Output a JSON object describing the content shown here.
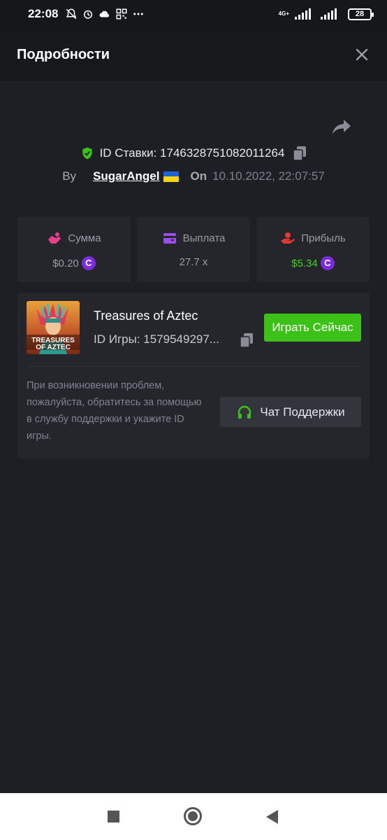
{
  "status_bar": {
    "time": "22:08",
    "network": "4G+",
    "battery": "28",
    "icons": [
      "mute-bell-icon",
      "alarm-icon",
      "cloud-icon",
      "qr-icon",
      "more-dots-icon",
      "signal-icon",
      "signal-icon",
      "battery-icon"
    ]
  },
  "header": {
    "title": "Подробности",
    "close_icon": "close-icon"
  },
  "bet": {
    "id_label": "ID Ставки: 1746328751082011264",
    "by_label": "By",
    "user": "SugarAngel",
    "on_label": "On",
    "date": "10.10.2022, 22:07:57"
  },
  "stats": {
    "amount": {
      "label": "Сумма",
      "value": "$0.20",
      "coin": "C"
    },
    "payout": {
      "label": "Выплата",
      "value": "27.7 x"
    },
    "profit": {
      "label": "Прибыль",
      "value": "$5.34",
      "coin": "C"
    }
  },
  "game": {
    "title": "Treasures of Aztec",
    "id_label": "ID Игры: 1579549297...",
    "thumb_text": "TREASURES OF AZTEC",
    "play_label": "Играть Сейчас",
    "help_text": "При возникновении проблем, пожалуйста, обратитесь за помощью в службу поддержки и укажите ID игры.",
    "support_label": "Чат Поддержки"
  },
  "colors": {
    "accent_green": "#3bc117",
    "profit_green": "#40d51b",
    "coin_purple": "#7b2bd9",
    "background": "#1e1f24",
    "card": "#25262c"
  }
}
